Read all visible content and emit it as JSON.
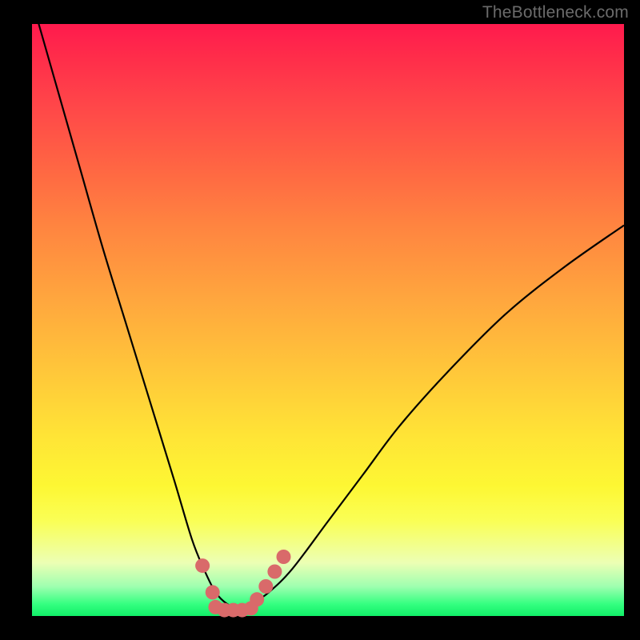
{
  "watermark": "TheBottleneck.com",
  "colors": {
    "background": "#000000",
    "curve": "#000000",
    "dot": "#d96a6a",
    "dot_stroke": "#bf5a5a"
  },
  "chart_data": {
    "type": "line",
    "title": "",
    "xlabel": "",
    "ylabel": "",
    "xlim": [
      0,
      100
    ],
    "ylim": [
      0,
      100
    ],
    "series": [
      {
        "name": "bottleneck-curve",
        "x": [
          0,
          4,
          8,
          12,
          16,
          20,
          24,
          27,
          29,
          31,
          33,
          35,
          37,
          40,
          44,
          50,
          56,
          62,
          70,
          80,
          90,
          100
        ],
        "y": [
          104,
          90,
          76,
          62,
          49,
          36,
          23,
          13,
          8,
          4,
          2,
          1.2,
          2,
          4,
          8,
          16,
          24,
          32,
          41,
          51,
          59,
          66
        ]
      }
    ],
    "markers": [
      {
        "x": 28.8,
        "y": 8.5
      },
      {
        "x": 30.5,
        "y": 4.0
      },
      {
        "x": 31.0,
        "y": 1.5
      },
      {
        "x": 32.5,
        "y": 1.0
      },
      {
        "x": 34.0,
        "y": 1.0
      },
      {
        "x": 35.5,
        "y": 1.0
      },
      {
        "x": 37.0,
        "y": 1.3
      },
      {
        "x": 38.0,
        "y": 2.8
      },
      {
        "x": 39.5,
        "y": 5.0
      },
      {
        "x": 41.0,
        "y": 7.5
      },
      {
        "x": 42.5,
        "y": 10.0
      }
    ],
    "marker_radius_px": 9
  }
}
